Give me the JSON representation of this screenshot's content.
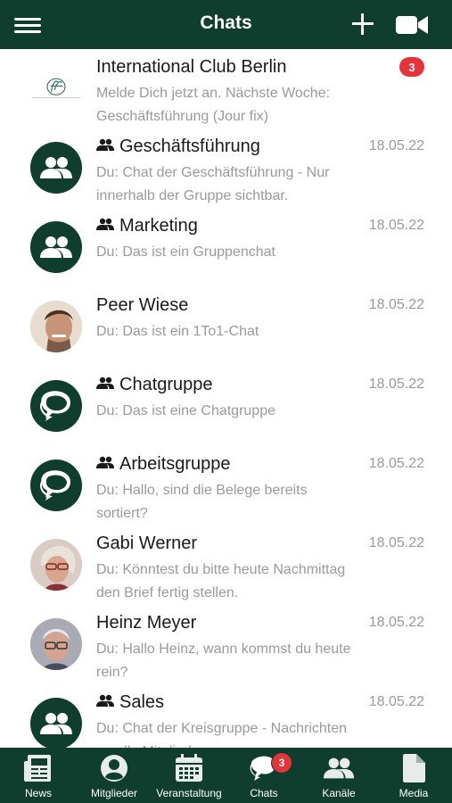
{
  "header": {
    "title": "Chats",
    "menu_icon": "hamburger-menu-icon",
    "plus_icon": "plus-icon",
    "video_icon": "video-camera-icon"
  },
  "theme": {
    "primary": "#0f3d2e",
    "badge": "#e5333a",
    "muted": "#9a9a9a"
  },
  "chats": [
    {
      "name": "International Club Berlin",
      "message": "Melde Dich jetzt an. Nächste Woche: Geschäftsführung (Jour fix)",
      "date": "",
      "unread": "3",
      "avatar": "club-logo",
      "group": false
    },
    {
      "name": "Geschäftsführung",
      "message": "Du: Chat der Geschäftsführung - Nur innerhalb der Gruppe sichtbar.",
      "date": "18.05.22",
      "avatar": "group-icon",
      "group": true
    },
    {
      "name": "Marketing",
      "message": "Du: Das ist ein Gruppenchat",
      "date": "18.05.22",
      "avatar": "group-icon",
      "group": true
    },
    {
      "name": "Peer Wiese",
      "message": "Du: Das ist ein 1To1-Chat",
      "date": "18.05.22",
      "avatar": "person-photo",
      "group": false
    },
    {
      "name": "Chatgruppe",
      "message": "Du: Das ist eine Chatgruppe",
      "date": "18.05.22",
      "avatar": "chat-bubbles-icon",
      "group": true
    },
    {
      "name": "Arbeitsgruppe",
      "message": "Du: Hallo, sind die Belege bereits sortiert?",
      "date": "18.05.22",
      "avatar": "chat-bubbles-icon",
      "group": true
    },
    {
      "name": "Gabi Werner",
      "message": "Du: Könntest du bitte heute Nachmittag den Brief fertig stellen.",
      "date": "18.05.22",
      "avatar": "person-photo",
      "group": false
    },
    {
      "name": "Heinz Meyer",
      "message": "Du: Hallo Heinz, wann kommst du heute rein?",
      "date": "18.05.22",
      "avatar": "person-photo",
      "group": false
    },
    {
      "name": "Sales",
      "message": "Du: Chat der Kreisgruppe - Nachrichten an alle Mitglieder",
      "date": "18.05.22",
      "avatar": "group-icon",
      "group": true
    }
  ],
  "tabs": [
    {
      "label": "News",
      "icon": "newspaper-icon"
    },
    {
      "label": "Mitglieder",
      "icon": "user-circle-icon"
    },
    {
      "label": "Veranstaltung",
      "icon": "calendar-icon"
    },
    {
      "label": "Chats",
      "icon": "chat-bubbles-icon",
      "badge": "3",
      "active": true
    },
    {
      "label": "Kanäle",
      "icon": "group-icon"
    },
    {
      "label": "Media",
      "icon": "document-icon"
    }
  ]
}
